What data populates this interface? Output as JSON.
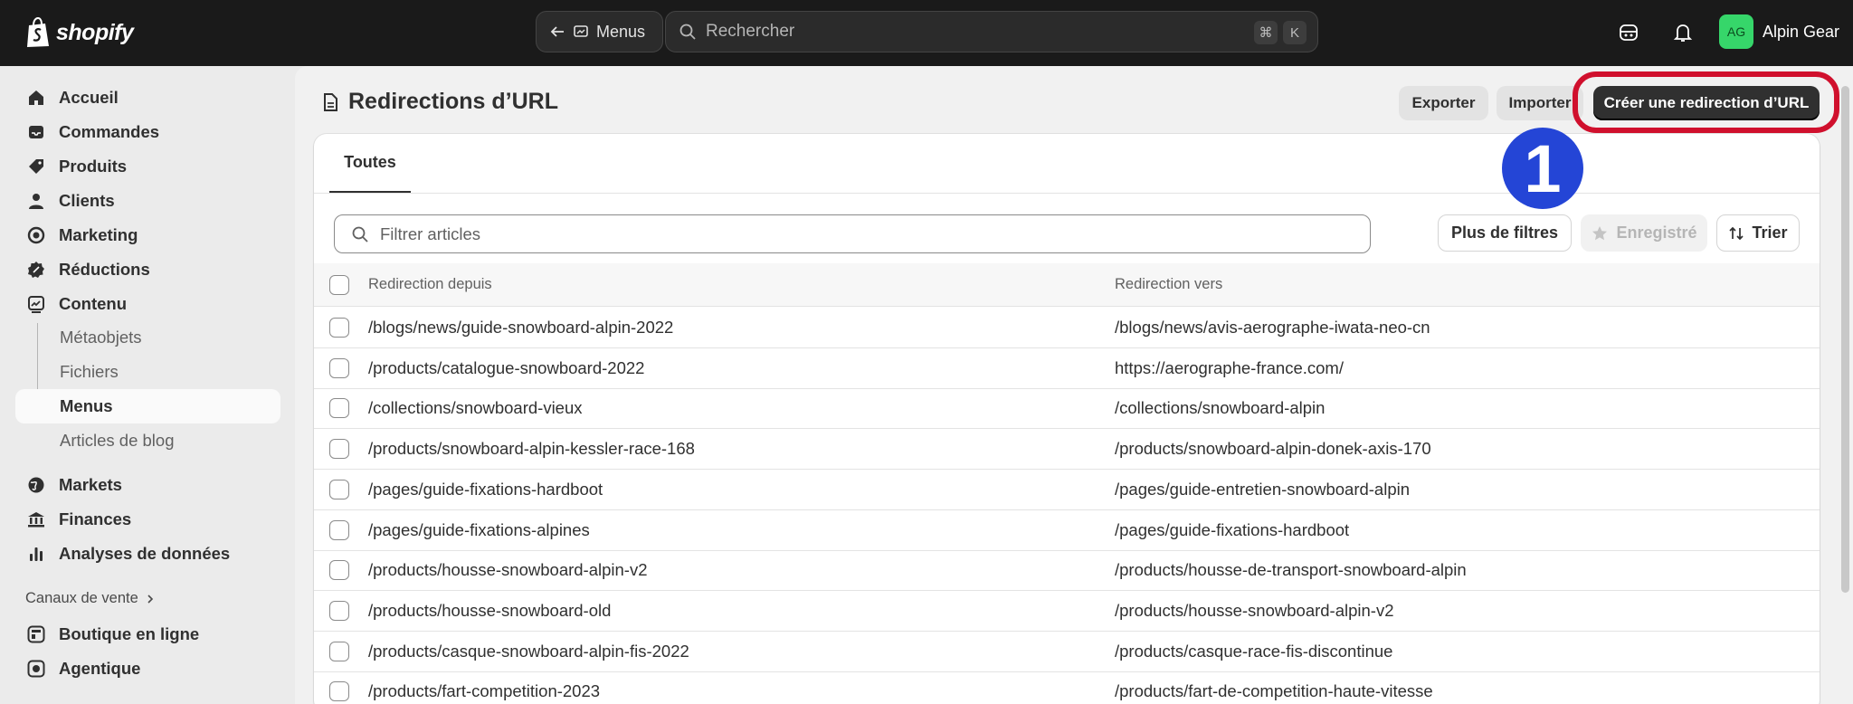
{
  "app": {
    "brand": "shopify"
  },
  "topbar": {
    "back_label": "Menus",
    "search_placeholder": "Rechercher",
    "shortcut_keys": [
      "⌘",
      "K"
    ],
    "account_initials": "AG",
    "account_name": "Alpin Gear"
  },
  "sidebar": {
    "items": [
      {
        "label": "Accueil",
        "icon": "home-icon"
      },
      {
        "label": "Commandes",
        "icon": "inbox-icon"
      },
      {
        "label": "Produits",
        "icon": "tag-icon"
      },
      {
        "label": "Clients",
        "icon": "person-icon"
      },
      {
        "label": "Marketing",
        "icon": "target-icon"
      },
      {
        "label": "Réductions",
        "icon": "discount-icon"
      },
      {
        "label": "Contenu",
        "icon": "content-icon"
      }
    ],
    "sub_items": [
      {
        "label": "Métaobjets",
        "active": false
      },
      {
        "label": "Fichiers",
        "active": false
      },
      {
        "label": "Menus",
        "active": true
      },
      {
        "label": "Articles de blog",
        "active": false
      }
    ],
    "items2": [
      {
        "label": "Markets",
        "icon": "globe-icon"
      },
      {
        "label": "Finances",
        "icon": "bank-icon"
      },
      {
        "label": "Analyses de données",
        "icon": "chart-icon"
      }
    ],
    "channels_label": "Canaux de vente",
    "channels": [
      {
        "label": "Boutique en ligne",
        "icon": "store-icon"
      },
      {
        "label": "Agentique",
        "icon": "agent-icon"
      }
    ]
  },
  "page": {
    "title": "Redirections d’URL",
    "export_label": "Exporter",
    "import_label": "Importer",
    "create_label": "Créer une redirection d’URL",
    "step_number": "1"
  },
  "tabs": [
    {
      "label": "Toutes",
      "active": true
    }
  ],
  "filters": {
    "search_placeholder": "Filtrer articles",
    "more_filters_label": "Plus de filtres",
    "saved_label": "Enregistré",
    "sort_label": "Trier"
  },
  "table": {
    "columns": [
      "Redirection depuis",
      "Redirection vers"
    ],
    "rows": [
      {
        "from": "/blogs/news/guide-snowboard-alpin-2022",
        "to": "/blogs/news/avis-aerographe-iwata-neo-cn"
      },
      {
        "from": "/products/catalogue-snowboard-2022",
        "to": "https://aerographe-france.com/"
      },
      {
        "from": "/collections/snowboard-vieux",
        "to": "/collections/snowboard-alpin"
      },
      {
        "from": "/products/snowboard-alpin-kessler-race-168",
        "to": "/products/snowboard-alpin-donek-axis-170"
      },
      {
        "from": "/pages/guide-fixations-hardboot",
        "to": "/pages/guide-entretien-snowboard-alpin"
      },
      {
        "from": "/pages/guide-fixations-alpines",
        "to": "/pages/guide-fixations-hardboot"
      },
      {
        "from": "/products/housse-snowboard-alpin-v2",
        "to": "/products/housse-de-transport-snowboard-alpin"
      },
      {
        "from": "/products/housse-snowboard-old",
        "to": "/products/housse-snowboard-alpin-v2"
      },
      {
        "from": "/products/casque-snowboard-alpin-fis-2022",
        "to": "/products/casque-race-fis-discontinue"
      },
      {
        "from": "/products/fart-competition-2023",
        "to": "/products/fart-de-competition-haute-vitesse"
      }
    ]
  },
  "colors": {
    "topbar": "#1a1a1a",
    "primary_button": "#303030",
    "highlight_ring": "#d0102d",
    "step_badge": "#2445d6",
    "avatar": "#36d66a"
  }
}
